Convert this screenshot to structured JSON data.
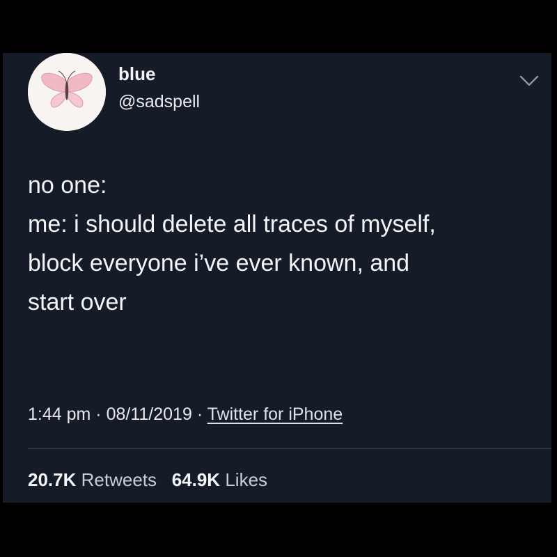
{
  "colors": {
    "background": "#000000",
    "card": "#151c28",
    "text": "#f4f5f7",
    "secondary": "#c9ced6",
    "avatar_bg": "#f7f4f2",
    "butterfly": "#f2b9c4"
  },
  "author": {
    "name": "blue",
    "handle": "@sadspell",
    "avatar_icon": "pink-butterfly"
  },
  "menu_icon": "chevron-down-icon",
  "tweet": {
    "lines": [
      "no one:",
      "me: i should delete all traces of myself,",
      "block everyone i’ve ever known, and",
      "start over"
    ]
  },
  "meta": {
    "time": "1:44 pm",
    "separator": "·",
    "date": "08/11/2019",
    "source": "Twitter for iPhone"
  },
  "stats": {
    "retweets_count": "20.7K",
    "retweets_label": "Retweets",
    "likes_count": "64.9K",
    "likes_label": "Likes"
  }
}
